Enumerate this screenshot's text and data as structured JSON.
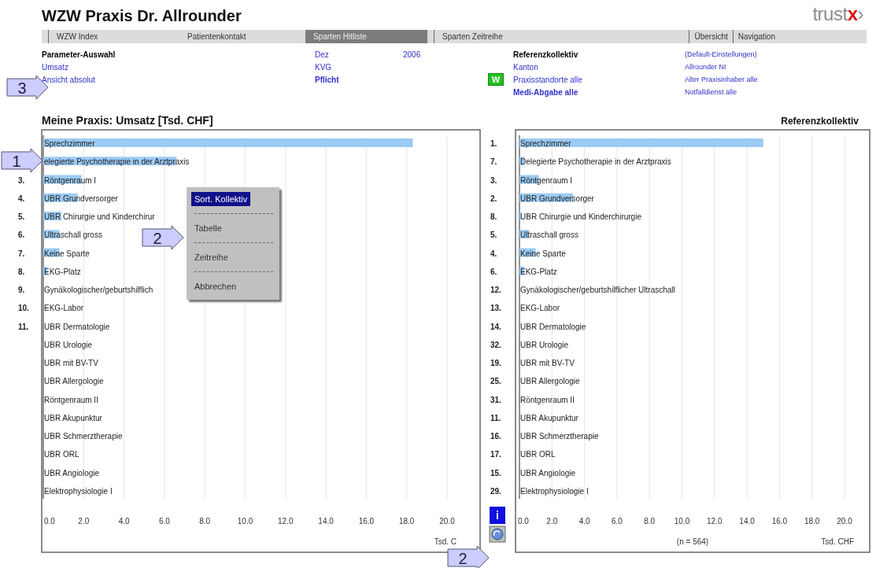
{
  "header": {
    "title": "WZW Praxis Dr. Allrounder",
    "logo": {
      "text": "trust",
      "accent": "x",
      "mark": "›"
    }
  },
  "nav": {
    "tabs": [
      {
        "label": "WZW Index",
        "selected": false
      },
      {
        "label": "Patientenkontakt",
        "selected": false
      },
      {
        "label": "Sparten Hitliste",
        "selected": true
      },
      {
        "label": "Sparten Zeitreihe",
        "selected": false
      }
    ],
    "links": [
      "Übersicht",
      "Navigation"
    ]
  },
  "parameter_rows": [
    [
      {
        "text": "Parameter-Auswahl",
        "kind": "heading"
      },
      {
        "text": "Dez",
        "kind": "link"
      },
      {
        "text": "2006",
        "kind": "link"
      },
      null,
      {
        "text": "Referenzkollektiv",
        "kind": "heading"
      },
      {
        "text": "(Default-Einstellungen)",
        "kind": "small-link"
      }
    ],
    [
      {
        "text": "Umsatz",
        "kind": "link"
      },
      {
        "text": "KVG",
        "kind": "link"
      },
      null,
      null,
      {
        "text": "Kanton",
        "kind": "link"
      },
      {
        "text": "Allrounder NI",
        "kind": "small-link"
      }
    ],
    [
      {
        "text": "Ansicht absolut",
        "kind": "link"
      },
      {
        "text": "Pflicht",
        "kind": "bold-link"
      },
      null,
      {
        "text": "W",
        "kind": "button"
      },
      {
        "text": "Praxisstandorte alle",
        "kind": "link"
      },
      {
        "text": "Alter Praxisinhaber alle",
        "kind": "small-link"
      }
    ],
    [
      null,
      null,
      null,
      null,
      {
        "text": "Medi-Abgabe alle",
        "kind": "bold-link"
      },
      {
        "text": "Notfalldienst alle",
        "kind": "small-link"
      }
    ]
  ],
  "left_chart": {
    "title": "Meine Praxis: Umsatz [Tsd. CHF]",
    "ranks": [
      {
        "hidden": true
      },
      {
        "hidden": true
      },
      {
        "label": "3.",
        "hidden": false
      },
      {
        "label": "4.",
        "hidden": false
      },
      {
        "label": "5.",
        "hidden": false
      },
      {
        "label": "6.",
        "hidden": false
      },
      {
        "label": "7.",
        "hidden": false
      },
      {
        "label": "8.",
        "hidden": false
      },
      {
        "label": "9.",
        "hidden": false
      },
      {
        "label": "10.",
        "hidden": false
      },
      {
        "label": "11.",
        "hidden": false
      }
    ],
    "chart_data": {
      "type": "bar",
      "orientation": "horizontal",
      "grid": true,
      "xlabel": "Tsd. C",
      "categories": [
        "Sprechzimmer",
        "elegierte Psychotherapie in der Arztpraxis",
        "Röntgenraum I",
        "UBR Grundversorger",
        "UBR Chirurgie und Kinderchirur",
        "Ultraschall gross",
        "Keine Sparte",
        "EKG-Platz",
        "Gynäkologischer/geburtshilflich",
        "EKG-Labor",
        "UBR Dermatologie",
        "UBR Urologie",
        "UBR mit BV-TV",
        "UBR Allergologie",
        "Röntgenraum II",
        "UBR Akupunktur",
        "UBR Schmerztherapie",
        "UBR ORL",
        "UBR Angiologie",
        "Elektrophysiologie I"
      ],
      "values": [
        18.3,
        6.6,
        1.9,
        1.7,
        0.9,
        0.8,
        0.8,
        0.2,
        0,
        0,
        0,
        0,
        0,
        0,
        0,
        0,
        0,
        0,
        0,
        0
      ],
      "xlim": [
        0,
        20
      ],
      "xticks": [
        {
          "value": 0,
          "label": "0.0"
        },
        {
          "value": 2,
          "label": "2.0"
        },
        {
          "value": 4,
          "label": "4.0"
        },
        {
          "value": 6,
          "label": "6.0"
        },
        {
          "value": 8,
          "label": "8.0"
        },
        {
          "value": 10,
          "label": "10.0"
        },
        {
          "value": 12,
          "label": "12.0"
        },
        {
          "value": 14,
          "label": "14.0"
        },
        {
          "value": 16,
          "label": "16.0"
        },
        {
          "value": 18,
          "label": "18.0"
        },
        {
          "value": 20,
          "label": "20.0"
        }
      ]
    }
  },
  "context_menu": {
    "items": [
      {
        "label": "Sort. Kollektiv",
        "selected": true
      },
      {
        "label": "Tabelle",
        "selected": false
      },
      {
        "label": "Zeitreihe",
        "selected": false
      },
      {
        "label": "Abbrechen",
        "selected": false
      }
    ]
  },
  "right_chart": {
    "title": "Referenzkollektiv",
    "note": "(n = 564)",
    "ranks": [
      {
        "label": "1.",
        "hidden": false
      },
      {
        "label": "7.",
        "hidden": false
      },
      {
        "label": "3.",
        "hidden": false
      },
      {
        "label": "2.",
        "hidden": false
      },
      {
        "label": "8.",
        "hidden": false
      },
      {
        "label": "5.",
        "hidden": false
      },
      {
        "label": "4.",
        "hidden": false
      },
      {
        "label": "6.",
        "hidden": false
      },
      {
        "label": "12.",
        "hidden": false
      },
      {
        "label": "13.",
        "hidden": false
      },
      {
        "label": "14.",
        "hidden": false
      },
      {
        "label": "32.",
        "hidden": false
      },
      {
        "label": "19.",
        "hidden": false
      },
      {
        "label": "25.",
        "hidden": false
      },
      {
        "label": "31.",
        "hidden": false
      },
      {
        "label": "11.",
        "hidden": false
      },
      {
        "label": "16.",
        "hidden": false
      },
      {
        "label": "17.",
        "hidden": false
      },
      {
        "label": "15.",
        "hidden": false
      },
      {
        "label": "29.",
        "hidden": false
      }
    ],
    "info_button": "i",
    "chart_data": {
      "type": "bar",
      "orientation": "horizontal",
      "grid": true,
      "xlabel": "Tsd. CHF",
      "categories": [
        "Sprechzimmer",
        "Delegierte Psychotherapie in der Arztpraxis",
        "Röntgenraum I",
        "UBR Grundversorger",
        "UBR Chirurgie und Kinderchirurgie",
        "Ultraschall gross",
        "Keine Sparte",
        "EKG-Platz",
        "Gynäkologischer/geburtshilflicher Ultraschall",
        "EKG-Labor",
        "UBR Dermatologie",
        "UBR Urologie",
        "UBR mit BV-TV",
        "UBR Allergologie",
        "Röntgenraum II",
        "UBR Akupunktur",
        "UBR Schmerztherapie",
        "UBR ORL",
        "UBR Angiologie",
        "Elektrophysiologie I"
      ],
      "values": [
        15.0,
        0.3,
        1.2,
        3.3,
        0.1,
        0.6,
        1.0,
        0.3,
        0,
        0,
        0,
        0,
        0,
        0,
        0,
        0,
        0,
        0,
        0,
        0
      ],
      "xlim": [
        0,
        20
      ],
      "xticks": [
        {
          "value": 0,
          "label": "0.0"
        },
        {
          "value": 2,
          "label": "2.0"
        },
        {
          "value": 4,
          "label": "4.0"
        },
        {
          "value": 6,
          "label": "6.0"
        },
        {
          "value": 8,
          "label": "8.0"
        },
        {
          "value": 10,
          "label": "10.0"
        },
        {
          "value": 12,
          "label": "12.0"
        },
        {
          "value": 14,
          "label": "14.0"
        },
        {
          "value": 16,
          "label": "16.0"
        },
        {
          "value": 18,
          "label": "18.0"
        },
        {
          "value": 20,
          "label": "20.0"
        }
      ]
    }
  },
  "callouts": [
    {
      "label": "3"
    },
    {
      "label": "1"
    },
    {
      "label": "2"
    },
    {
      "label": "2"
    }
  ]
}
